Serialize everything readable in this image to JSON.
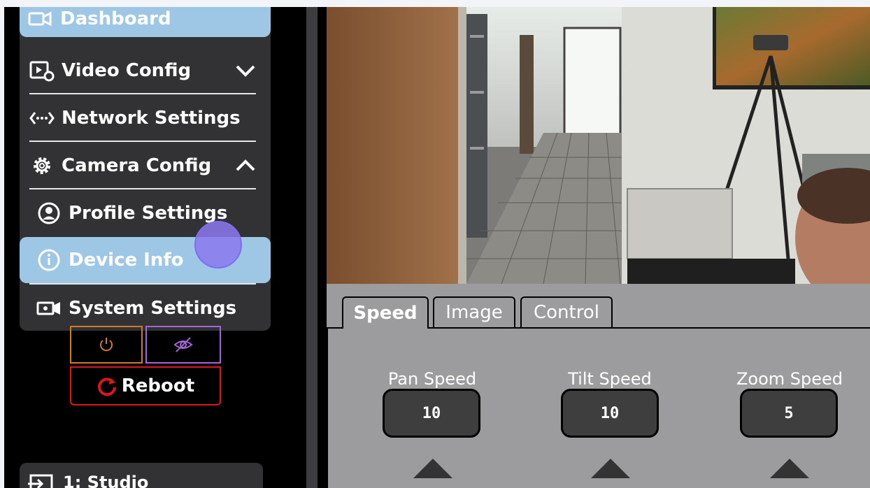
{
  "sidebar": {
    "items": [
      {
        "label": "Dashboard",
        "icon": "video-camera-icon"
      },
      {
        "label": "Video Config",
        "icon": "video-settings-icon",
        "chevron": "down"
      },
      {
        "label": "Network Settings",
        "icon": "network-icon"
      },
      {
        "label": "Camera Config",
        "icon": "gear-icon",
        "chevron": "up"
      },
      {
        "label": "Profile Settings",
        "icon": "user-circle-icon"
      },
      {
        "label": "Device Info",
        "icon": "info-icon"
      },
      {
        "label": "System Settings",
        "icon": "system-camera-icon"
      }
    ],
    "active_item": "Device Info"
  },
  "controls": {
    "power_icon": "power-icon",
    "privacy_icon": "eye-off-icon",
    "reboot_label": "Reboot"
  },
  "source": {
    "label": "1: Studio"
  },
  "panel": {
    "tabs": [
      {
        "label": "Speed",
        "active": true
      },
      {
        "label": "Image",
        "active": false
      },
      {
        "label": "Control",
        "active": false
      }
    ],
    "speeds": [
      {
        "label": "Pan Speed",
        "value": "10"
      },
      {
        "label": "Tilt Speed",
        "value": "10"
      },
      {
        "label": "Zoom Speed",
        "value": "5"
      }
    ]
  },
  "colors": {
    "active_menu": "#9dc7e5",
    "menu_bg": "#323234",
    "panel_bg": "#9c9c9e",
    "power_border": "#d07a2c",
    "privacy_border": "#a565d8",
    "reboot_border": "#e0141b"
  }
}
